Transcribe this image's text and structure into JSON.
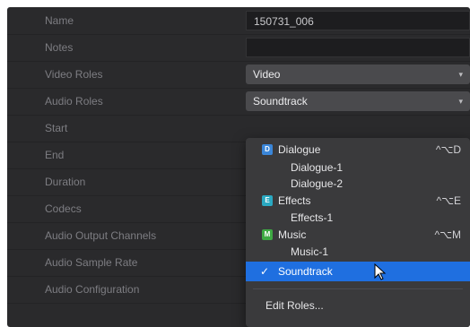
{
  "inspector": {
    "rows": [
      {
        "label": "Name",
        "value": "150731_006"
      },
      {
        "label": "Notes",
        "value": ""
      },
      {
        "label": "Video Roles",
        "value": "Video"
      },
      {
        "label": "Audio Roles",
        "value": "Soundtrack"
      },
      {
        "label": "Start",
        "value": ""
      },
      {
        "label": "End",
        "value": ""
      },
      {
        "label": "Duration",
        "value": ""
      },
      {
        "label": "Codecs",
        "value": ""
      },
      {
        "label": "Audio Output Channels",
        "value": ""
      },
      {
        "label": "Audio Sample Rate",
        "value": ""
      },
      {
        "label": "Audio Configuration",
        "value": ""
      }
    ]
  },
  "roles_menu": {
    "items": [
      {
        "label": "Dialogue",
        "shortcut": "^⌥D",
        "swatch": "D",
        "color": "#3a86d9"
      },
      {
        "label": "Dialogue-1"
      },
      {
        "label": "Dialogue-2"
      },
      {
        "label": "Effects",
        "shortcut": "^⌥E",
        "swatch": "E",
        "color": "#2aa9c2"
      },
      {
        "label": "Effects-1"
      },
      {
        "label": "Music",
        "shortcut": "^⌥M",
        "swatch": "M",
        "color": "#3eaa43"
      },
      {
        "label": "Music-1"
      },
      {
        "label": "Soundtrack",
        "check": "✓"
      }
    ],
    "edit_label": "Edit Roles..."
  }
}
